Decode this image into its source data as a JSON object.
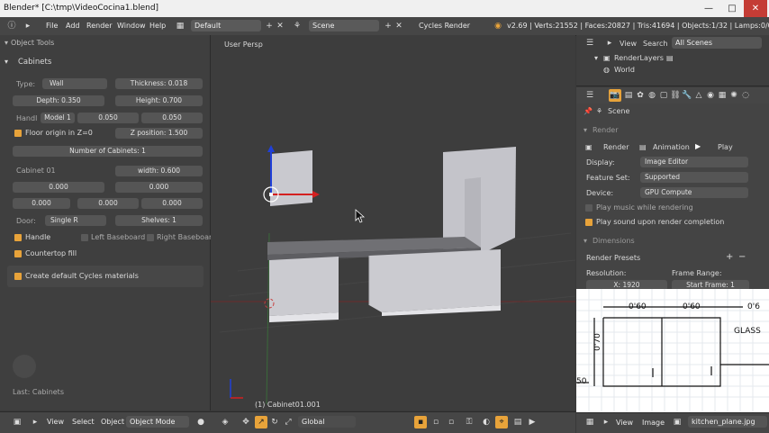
{
  "window": {
    "title": "Blender* [C:\\tmp\\VideoCocina1.blend]",
    "minimize": "—",
    "maximize": "□",
    "close": "✕"
  },
  "info_header": {
    "menus": [
      "File",
      "Add",
      "Render",
      "Window",
      "Help"
    ],
    "layout": "Default",
    "scene": "Scene",
    "engine": "Cycles Render",
    "stats": "v2.69 | Verts:21552 | Faces:20827 | Tris:41694 | Objects:1/32 | Lamps:0/0 | Mem:1"
  },
  "tool_panel": {
    "header": "Object Tools",
    "section": "Cabinets",
    "type_label": "Type:",
    "type_value": "Wall",
    "thickness": "Thickness: 0.018",
    "depth": "Depth: 0.350",
    "height": "Height: 0.700",
    "handle_label": "Handl",
    "handle_model": "Model 1",
    "handle_x": "0.050",
    "handle_y": "0.050",
    "floor_origin": "Floor origin in Z=0",
    "z_position": "Z position: 1.500",
    "num_cabinets": "Number of Cabinets: 1",
    "cabinet_label": "Cabinet 01",
    "width": "width: 0.600",
    "v1": "0.000",
    "v2": "0.000",
    "v3": "0.000",
    "v4": "0.000",
    "v5": "0.000",
    "door_label": "Door:",
    "door_value": "Single R",
    "shelves": "Shelves: 1",
    "handle_chk": "Handle",
    "left_baseboard": "Left Baseboard",
    "right_baseboard": "Right Baseboar",
    "countertop": "Countertop fill",
    "cycles_materials": "Create default Cycles materials",
    "last_op": "Last: Cabinets"
  },
  "viewport": {
    "view_name": "User Persp",
    "object_info": "(1) Cabinet01.001"
  },
  "bottom_header": {
    "view": "View",
    "select": "Select",
    "object": "Object",
    "mode": "Object Mode",
    "orientation": "Global"
  },
  "outliner": {
    "view": "View",
    "search": "Search",
    "scenes": "All Scenes",
    "item1": "RenderLayers",
    "item2": "World"
  },
  "properties": {
    "scene": "Scene",
    "render_panel": "Render",
    "render_btn": "Render",
    "animation_btn": "Animation",
    "play_btn": "Play",
    "display_label": "Display:",
    "display_value": "Image Editor",
    "feature_label": "Feature Set:",
    "feature_value": "Supported",
    "device_label": "Device:",
    "device_value": "GPU Compute",
    "play_music": "Play music while rendering",
    "play_sound": "Play sound upon render completion",
    "dimensions_panel": "Dimensions",
    "presets": "Render Presets",
    "resolution_label": "Resolution:",
    "frame_range_label": "Frame Range:",
    "res_x": "X: 1920",
    "start_frame": "Start Frame: 1"
  },
  "image_editor": {
    "dim1": "0'60",
    "dim2": "0'60",
    "dim3": "0'6",
    "dim_v": "0'70",
    "label": "GLASS",
    "small": "50",
    "view": "View",
    "image": "Image",
    "image_name": "kitchen_plane.jpg"
  },
  "colors": {
    "accent": "#e8a33a",
    "panel": "#3f3f3f",
    "viewport_bg": "#3d3d3d",
    "x_axis": "#d42020",
    "y_axis": "#2a9a2a",
    "z_axis": "#2040d8"
  }
}
